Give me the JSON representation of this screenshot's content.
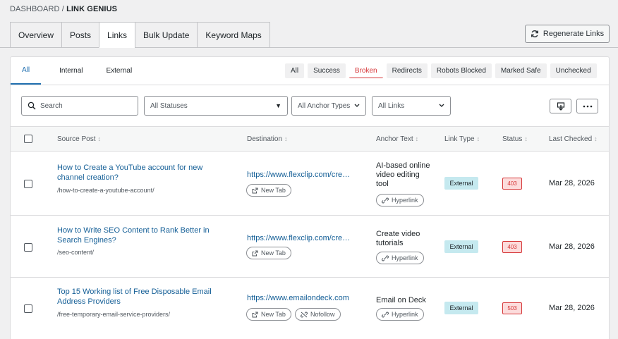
{
  "breadcrumb": {
    "parent": "DASHBOARD",
    "sep": "/",
    "current": "LINK GENIUS"
  },
  "tabs": [
    "Overview",
    "Posts",
    "Links",
    "Bulk Update",
    "Keyword Maps"
  ],
  "regenerate_label": "Regenerate Links",
  "subtabs": [
    "All",
    "Internal",
    "External"
  ],
  "filters": [
    "All",
    "Success",
    "Broken",
    "Redirects",
    "Robots Blocked",
    "Marked Safe",
    "Unchecked"
  ],
  "search": {
    "placeholder": "Search"
  },
  "selects": {
    "status": "All Statuses",
    "anchor": "All Anchor Types",
    "links": "All Links"
  },
  "columns": {
    "source": "Source Post",
    "destination": "Destination",
    "anchor": "Anchor Text",
    "type": "Link Type",
    "status": "Status",
    "checked": "Last Checked"
  },
  "rows": [
    {
      "title": "How to Create a YouTube account for new channel creation?",
      "slug": "/how-to-create-a-youtube-account/",
      "dest": "https://www.flexclip.com/create/ai-video",
      "new_tab": "New Tab",
      "anchor": "AI-based online video editing tool",
      "anchor_type": "Hyperlink",
      "link_type": "External",
      "status": "403",
      "date": "Mar 28, 2026"
    },
    {
      "title": "How to Write SEO Content to Rank Better in Search Engines?",
      "slug": "/seo-content/",
      "dest": "https://www.flexclip.com/create/tutorials",
      "new_tab": "New Tab",
      "anchor": "Create video tutorials",
      "anchor_type": "Hyperlink",
      "link_type": "External",
      "status": "403",
      "date": "Mar 28, 2026"
    },
    {
      "title": "Top 15 Working list of Free Disposable Email Address Providers",
      "slug": "/free-temporary-email-service-providers/",
      "dest": "https://www.emailondeck.com",
      "new_tab": "New Tab",
      "nofollow": "Nofollow",
      "anchor": "Email on Deck",
      "anchor_type": "Hyperlink",
      "link_type": "External",
      "status": "503",
      "date": "Mar 28, 2026"
    }
  ]
}
